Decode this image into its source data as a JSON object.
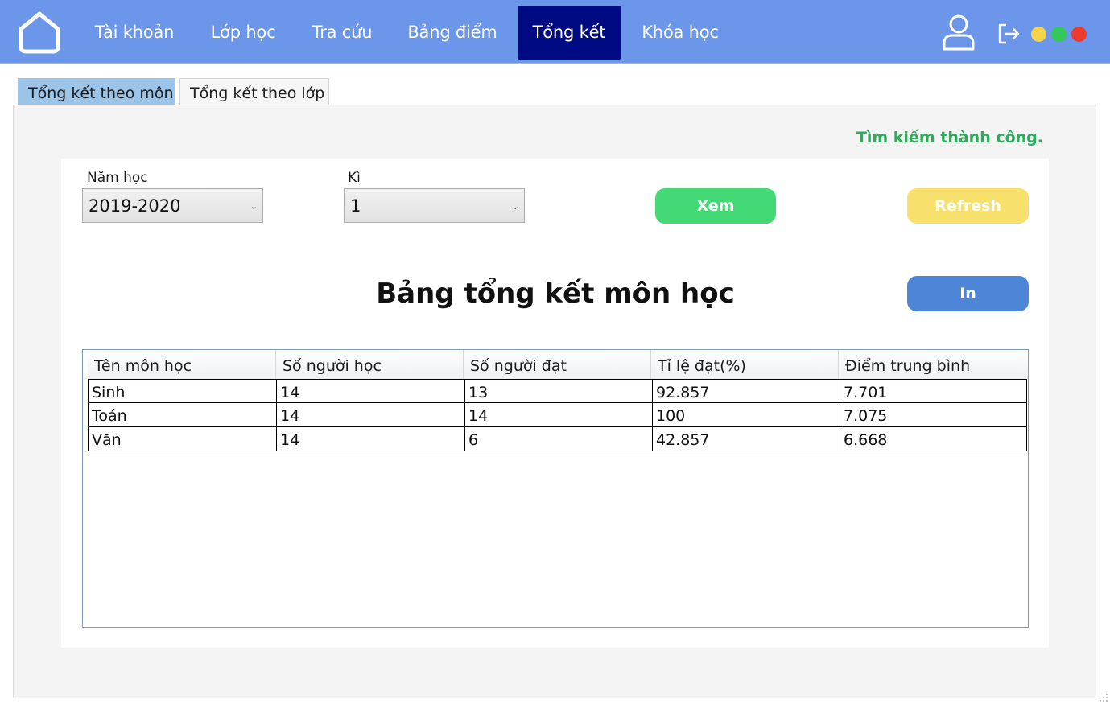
{
  "nav": {
    "items": [
      "Tài khoản",
      "Lớp học",
      "Tra cứu",
      "Bảng điểm",
      "Tổng kết",
      "Khóa học"
    ],
    "active_index": 4
  },
  "window_controls": {
    "colors": [
      "#f5d547",
      "#34c759",
      "#f03a2e"
    ]
  },
  "tabs": {
    "items": [
      "Tổng kết theo môn",
      "Tổng kết theo lớp"
    ],
    "active_index": 0
  },
  "status": {
    "message": "Tìm kiếm thành công.",
    "color": "#2eaa5c"
  },
  "filters": {
    "year_label": "Năm học",
    "year_value": "2019-2020",
    "term_label": "Kì",
    "term_value": "1"
  },
  "buttons": {
    "view_label": "Xem",
    "refresh_label": "Refresh",
    "print_label": "In",
    "view_color": "#43da75",
    "refresh_color": "#f7e06c",
    "print_color": "#4d86d6"
  },
  "title": "Bảng tổng kết môn học",
  "table": {
    "columns": [
      "Tên môn học",
      "Số người học",
      "Số người đạt",
      "Tỉ lệ đạt(%)",
      "Điểm trung bình"
    ],
    "rows": [
      [
        "Sinh",
        "14",
        "13",
        "92.857",
        "7.701"
      ],
      [
        "Toán",
        "14",
        "14",
        "100",
        "7.075"
      ],
      [
        "Văn",
        "14",
        "6",
        "42.857",
        "6.668"
      ]
    ]
  },
  "theme": {
    "topbar_color": "#6b96e9",
    "active_nav_color": "#000a82"
  }
}
